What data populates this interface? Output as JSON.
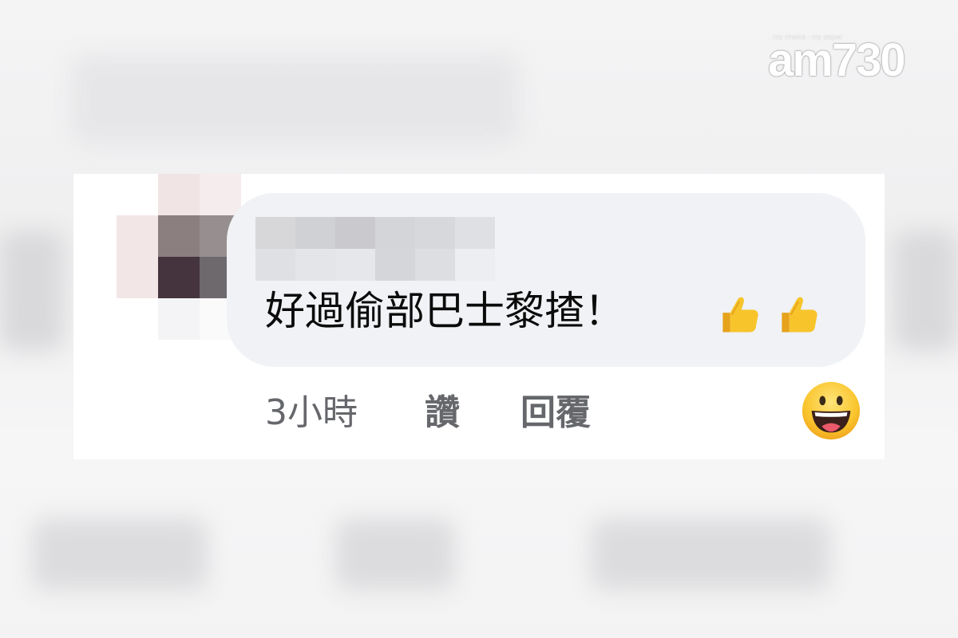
{
  "logo": {
    "tagline": "my choice · my paper",
    "name": "am730"
  },
  "comment": {
    "text": "好過偷部巴士黎揸！",
    "emoji_icons": [
      "thumbs-up-icon",
      "thumbs-up-icon"
    ],
    "time": "3小時",
    "like_label": "讚",
    "reply_label": "回覆",
    "reaction_icon": "grinning-face-icon"
  },
  "colors": {
    "bubble_bg": "#f0f2f5",
    "action_text": "#65676b",
    "emoji_yellow": "#f7c42c"
  }
}
